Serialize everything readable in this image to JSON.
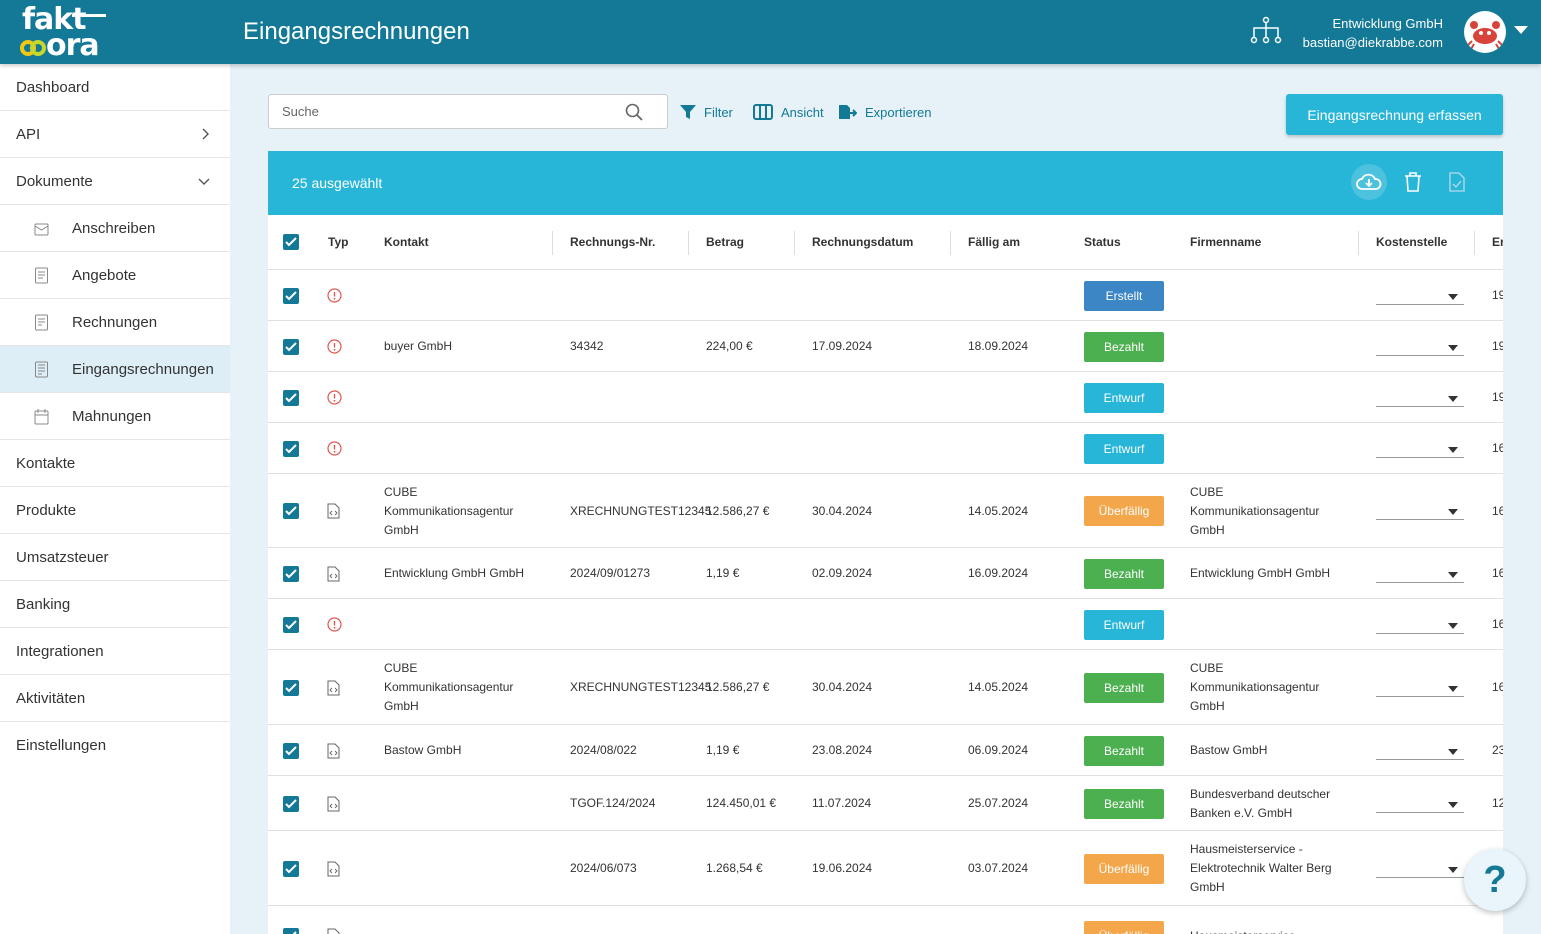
{
  "header": {
    "logo_line1": "fakt",
    "logo_line2": "ora",
    "title": "Eingangsrechnungen",
    "company": "Entwicklung GmbH",
    "email": "bastian@diekrabbe.com"
  },
  "sidebar": {
    "items": [
      {
        "label": "Dashboard"
      },
      {
        "label": "API"
      },
      {
        "label": "Dokumente"
      },
      {
        "label": "Anschreiben"
      },
      {
        "label": "Angebote"
      },
      {
        "label": "Rechnungen"
      },
      {
        "label": "Eingangsrechnungen"
      },
      {
        "label": "Mahnungen"
      },
      {
        "label": "Kontakte"
      },
      {
        "label": "Produkte"
      },
      {
        "label": "Umsatzsteuer"
      },
      {
        "label": "Banking"
      },
      {
        "label": "Integrationen"
      },
      {
        "label": "Aktivitäten"
      },
      {
        "label": "Einstellungen"
      }
    ]
  },
  "toolbar": {
    "search_placeholder": "Suche",
    "filter_label": "Filter",
    "view_label": "Ansicht",
    "export_label": "Exportieren",
    "primary_label": "Eingangsrechnung erfassen"
  },
  "selection": {
    "label": "25 ausgewählt"
  },
  "table": {
    "columns": [
      "Typ",
      "Kontakt",
      "Rechnungs-Nr.",
      "Betrag",
      "Rechnungsdatum",
      "Fällig am",
      "Status",
      "Firmenname",
      "Kostenstelle",
      "Er"
    ],
    "rows": [
      {
        "kontakt": "",
        "nr": "",
        "betrag": "",
        "datum": "",
        "faellig": "",
        "status": "Erstellt",
        "firma": "",
        "cut": "19"
      },
      {
        "kontakt": "buyer GmbH",
        "nr": "34342",
        "betrag": "224,00 €",
        "datum": "17.09.2024",
        "faellig": "18.09.2024",
        "status": "Bezahlt",
        "firma": "",
        "cut": "19"
      },
      {
        "kontakt": "",
        "nr": "",
        "betrag": "",
        "datum": "",
        "faellig": "",
        "status": "Entwurf",
        "firma": "",
        "cut": "19"
      },
      {
        "kontakt": "",
        "nr": "",
        "betrag": "",
        "datum": "",
        "faellig": "",
        "status": "Entwurf",
        "firma": "",
        "cut": "16"
      },
      {
        "kontakt": "CUBE Kommunikationsagentur GmbH",
        "nr": "XRECHNUNGTEST12345",
        "betrag": "12.586,27 €",
        "datum": "30.04.2024",
        "faellig": "14.05.2024",
        "status": "Überfällig",
        "firma": "CUBE Kommunikationsagentur GmbH",
        "cut": "16"
      },
      {
        "kontakt": "Entwicklung GmbH GmbH",
        "nr": "2024/09/01273",
        "betrag": "1,19 €",
        "datum": "02.09.2024",
        "faellig": "16.09.2024",
        "status": "Bezahlt",
        "firma": "Entwicklung GmbH GmbH",
        "cut": "16"
      },
      {
        "kontakt": "",
        "nr": "",
        "betrag": "",
        "datum": "",
        "faellig": "",
        "status": "Entwurf",
        "firma": "",
        "cut": "16"
      },
      {
        "kontakt": "CUBE Kommunikationsagentur GmbH",
        "nr": "XRECHNUNGTEST12345",
        "betrag": "12.586,27 €",
        "datum": "30.04.2024",
        "faellig": "14.05.2024",
        "status": "Bezahlt",
        "firma": "CUBE Kommunikationsagentur GmbH",
        "cut": "16"
      },
      {
        "kontakt": "Bastow GmbH",
        "nr": "2024/08/022",
        "betrag": "1,19 €",
        "datum": "23.08.2024",
        "faellig": "06.09.2024",
        "status": "Bezahlt",
        "firma": "Bastow GmbH",
        "cut": "23"
      },
      {
        "kontakt": "",
        "nr": "TGOF.124/2024",
        "betrag": "124.450,01 €",
        "datum": "11.07.2024",
        "faellig": "25.07.2024",
        "status": "Bezahlt",
        "firma": "Bundesverband deutscher Banken e.V. GmbH",
        "cut": "12"
      },
      {
        "kontakt": "",
        "nr": "2024/06/073",
        "betrag": "1.268,54 €",
        "datum": "19.06.2024",
        "faellig": "03.07.2024",
        "status": "Überfällig",
        "firma": "Hausmeisterservice - Elektrotechnik Walter Berg GmbH",
        "cut": ""
      },
      {
        "kontakt": "",
        "nr": "",
        "betrag": "",
        "datum": "",
        "faellig": "",
        "status": "Überfällig",
        "firma": "Hausmeisterservice -",
        "cut": ""
      }
    ]
  },
  "help": {
    "label": "?"
  },
  "colors": {
    "header": "#137996",
    "accent": "#27b5d8",
    "bezahlt": "#4caf50",
    "entwurf": "#27b5d8",
    "erstellt": "#3d86c6",
    "ueberfaellig": "#f3a64a",
    "warn": "#e0574f"
  }
}
